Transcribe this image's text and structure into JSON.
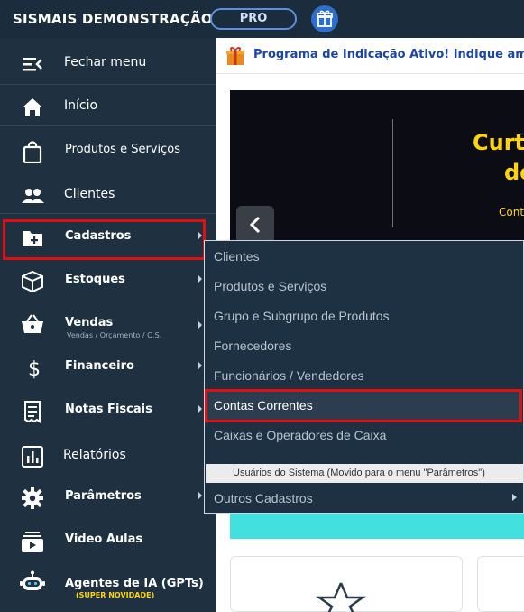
{
  "header": {
    "app_title": "SISMAIS DEMONSTRAÇÃO",
    "plan_badge": "PRO",
    "gift_icon": "gift-icon"
  },
  "sidebar": {
    "items": [
      {
        "label": "Fechar menu",
        "icon": "menu-collapse-icon"
      },
      {
        "label": "Início",
        "icon": "home-icon"
      },
      {
        "label": "Produtos e Serviços",
        "icon": "shopping-bag-icon"
      },
      {
        "label": "Clientes",
        "icon": "people-icon"
      },
      {
        "label": "Cadastros",
        "icon": "folder-plus-icon"
      },
      {
        "label": "Estoques",
        "icon": "box-icon"
      },
      {
        "label": "Vendas",
        "sub": "Vendas / Orçamento / O.S.",
        "icon": "basket-icon"
      },
      {
        "label": "Financeiro",
        "icon": "dollar-icon"
      },
      {
        "label": "Notas Fiscais",
        "icon": "receipt-icon"
      },
      {
        "label": "Relatórios",
        "icon": "bar-chart-icon"
      },
      {
        "label": "Parâmetros",
        "icon": "gear-icon"
      },
      {
        "label": "Video Aulas",
        "icon": "video-library-icon"
      },
      {
        "label": "Agentes de IA (GPTs)",
        "sub": "(SUPER NOVIDADE)",
        "icon": "robot-icon"
      }
    ]
  },
  "banner": {
    "text": "Programa de Indicação Ativo! Indique amig"
  },
  "carousel": {
    "headline_1": "Curti",
    "headline_2": "do",
    "subtext": "Cont"
  },
  "cadastros_menu": {
    "items": [
      "Clientes",
      "Produtos e Serviços",
      "Grupo e Subgrupo de Produtos",
      "Fornecedores",
      "Funcionários / Vendedores",
      "Contas Correntes",
      "Caixas e Operadores de Caixa"
    ],
    "note": "Usuários do Sistema (Movido para o menu \"Parâmetros\")",
    "more": "Outros Cadastros"
  },
  "colors": {
    "sidebar_bg": "#1f3141",
    "accent_blue": "#2c6fcf",
    "highlight_red": "#e01010",
    "carousel_yellow": "#ffd400",
    "cyan": "#42e0de"
  }
}
